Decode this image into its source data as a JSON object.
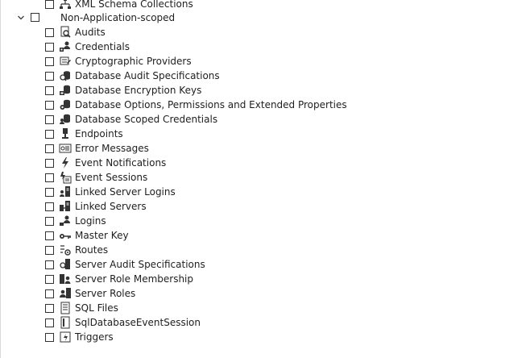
{
  "tree": {
    "top_item": {
      "label": "XML Schema Collections",
      "icon": "schema-icon"
    },
    "group": {
      "label": "Non-Application-scoped",
      "expanded": true
    },
    "items": [
      {
        "label": "Audits",
        "icon": "audit-icon"
      },
      {
        "label": "Credentials",
        "icon": "credential-icon"
      },
      {
        "label": "Cryptographic Providers",
        "icon": "crypto-provider-icon"
      },
      {
        "label": "Database Audit Specifications",
        "icon": "db-audit-spec-icon"
      },
      {
        "label": "Database Encryption Keys",
        "icon": "db-encryption-key-icon"
      },
      {
        "label": "Database Options, Permissions and Extended Properties",
        "icon": "db-options-icon"
      },
      {
        "label": "Database Scoped Credentials",
        "icon": "db-scoped-credential-icon"
      },
      {
        "label": "Endpoints",
        "icon": "endpoint-icon"
      },
      {
        "label": "Error Messages",
        "icon": "error-message-icon"
      },
      {
        "label": "Event Notifications",
        "icon": "event-notification-icon"
      },
      {
        "label": "Event Sessions",
        "icon": "event-session-icon"
      },
      {
        "label": "Linked Server Logins",
        "icon": "linked-server-login-icon"
      },
      {
        "label": "Linked Servers",
        "icon": "linked-server-icon"
      },
      {
        "label": "Logins",
        "icon": "login-icon"
      },
      {
        "label": "Master Key",
        "icon": "master-key-icon"
      },
      {
        "label": "Routes",
        "icon": "route-icon"
      },
      {
        "label": "Server Audit Specifications",
        "icon": "server-audit-spec-icon"
      },
      {
        "label": "Server Role Membership",
        "icon": "server-role-membership-icon"
      },
      {
        "label": "Server Roles",
        "icon": "server-role-icon"
      },
      {
        "label": "SQL Files",
        "icon": "sql-file-icon"
      },
      {
        "label": "SqlDatabaseEventSession",
        "icon": "sql-db-event-session-icon"
      },
      {
        "label": "Triggers",
        "icon": "trigger-icon"
      }
    ]
  }
}
